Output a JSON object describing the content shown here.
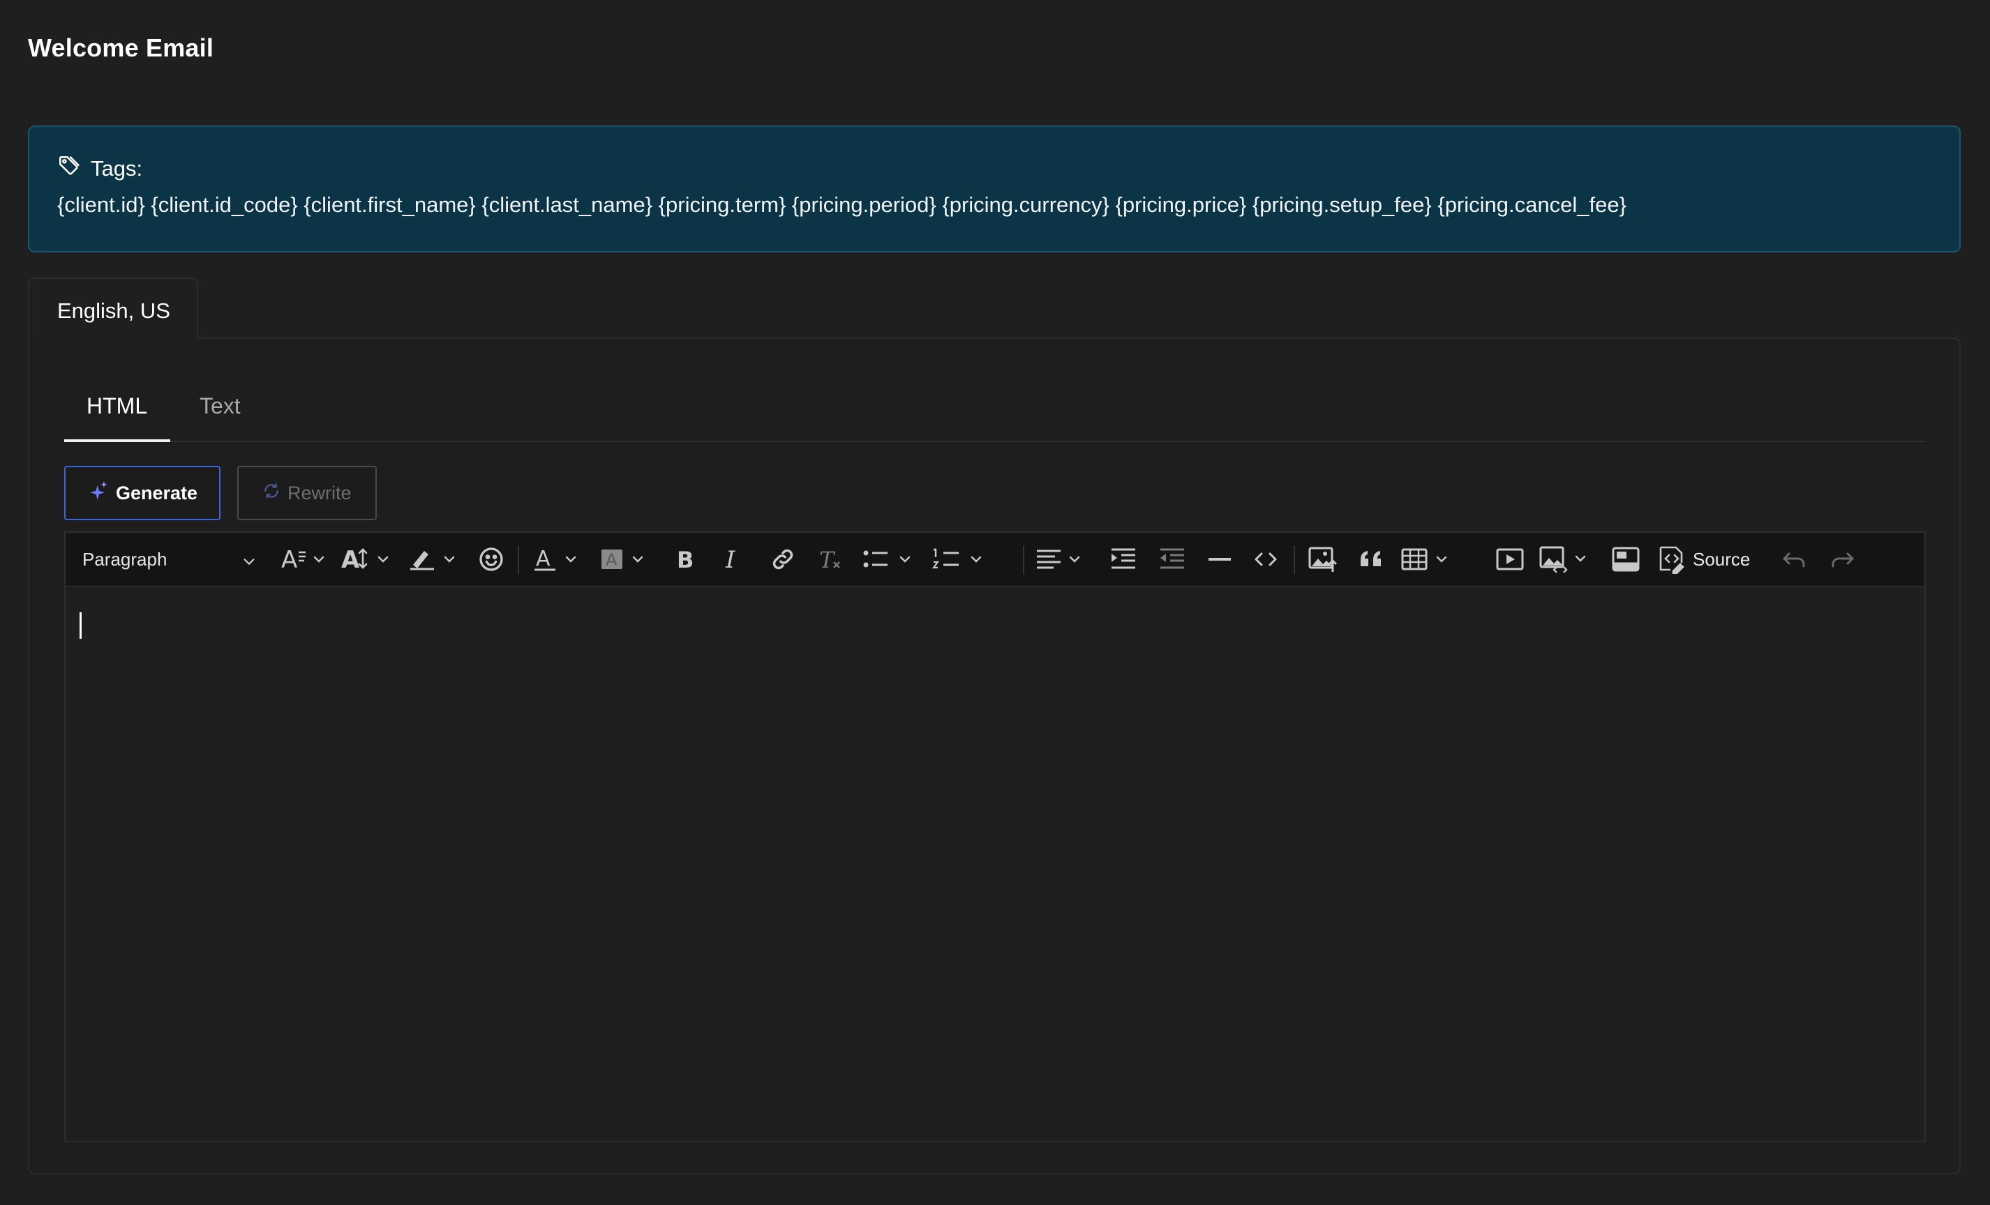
{
  "page": {
    "title": "Welcome Email"
  },
  "tags": {
    "heading": "Tags:",
    "list": "{client.id} {client.id_code} {client.first_name} {client.last_name} {pricing.term} {pricing.period} {pricing.currency} {pricing.price} {pricing.setup_fee} {pricing.cancel_fee}"
  },
  "language_tab": {
    "label": "English, US"
  },
  "mode_tabs": {
    "html": "HTML",
    "text": "Text",
    "active": "HTML"
  },
  "actions": {
    "generate": "Generate",
    "rewrite": "Rewrite"
  },
  "toolbar": {
    "block_format": "Paragraph",
    "source_label": "Source",
    "icons": [
      "font-family-icon",
      "font-size-icon",
      "highlight-icon",
      "emoji-icon",
      "font-color-icon",
      "background-color-icon",
      "bold-icon",
      "italic-icon",
      "link-icon",
      "remove-format-icon",
      "bulleted-list-icon",
      "numbered-list-icon",
      "align-icon",
      "indent-icon",
      "outdent-icon",
      "horizontal-line-icon",
      "code-icon",
      "insert-image-icon",
      "blockquote-icon",
      "table-icon",
      "media-embed-icon",
      "html-embed-icon",
      "template-icon",
      "source-icon",
      "undo-icon",
      "redo-icon"
    ]
  },
  "colors": {
    "background": "#1f1f1f",
    "tags_panel_bg": "#0b3447",
    "tags_panel_border": "#1b5670",
    "generate_border": "#3b66d9",
    "sparkle_accent": "#6b7cff"
  }
}
